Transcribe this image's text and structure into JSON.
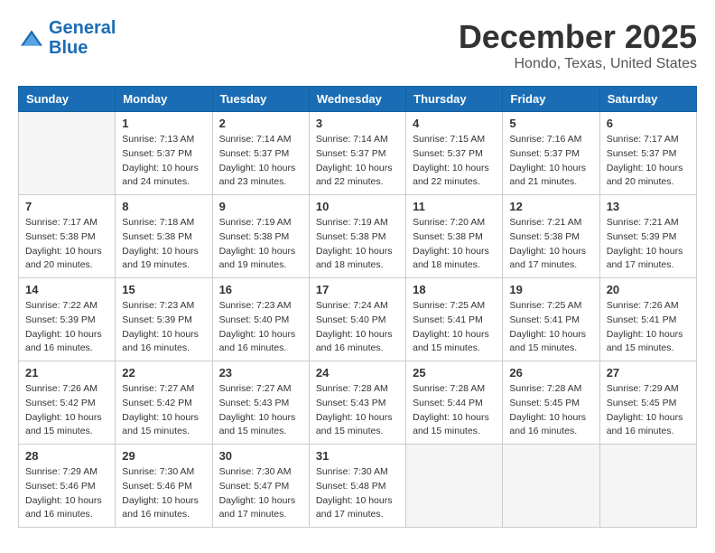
{
  "logo": {
    "line1": "General",
    "line2": "Blue"
  },
  "title": "December 2025",
  "location": "Hondo, Texas, United States",
  "days_of_week": [
    "Sunday",
    "Monday",
    "Tuesday",
    "Wednesday",
    "Thursday",
    "Friday",
    "Saturday"
  ],
  "weeks": [
    [
      {
        "day": "",
        "empty": true
      },
      {
        "day": "1",
        "sunrise": "7:13 AM",
        "sunset": "5:37 PM",
        "daylight": "10 hours and 24 minutes."
      },
      {
        "day": "2",
        "sunrise": "7:14 AM",
        "sunset": "5:37 PM",
        "daylight": "10 hours and 23 minutes."
      },
      {
        "day": "3",
        "sunrise": "7:14 AM",
        "sunset": "5:37 PM",
        "daylight": "10 hours and 22 minutes."
      },
      {
        "day": "4",
        "sunrise": "7:15 AM",
        "sunset": "5:37 PM",
        "daylight": "10 hours and 22 minutes."
      },
      {
        "day": "5",
        "sunrise": "7:16 AM",
        "sunset": "5:37 PM",
        "daylight": "10 hours and 21 minutes."
      },
      {
        "day": "6",
        "sunrise": "7:17 AM",
        "sunset": "5:37 PM",
        "daylight": "10 hours and 20 minutes."
      }
    ],
    [
      {
        "day": "7",
        "sunrise": "7:17 AM",
        "sunset": "5:38 PM",
        "daylight": "10 hours and 20 minutes."
      },
      {
        "day": "8",
        "sunrise": "7:18 AM",
        "sunset": "5:38 PM",
        "daylight": "10 hours and 19 minutes."
      },
      {
        "day": "9",
        "sunrise": "7:19 AM",
        "sunset": "5:38 PM",
        "daylight": "10 hours and 19 minutes."
      },
      {
        "day": "10",
        "sunrise": "7:19 AM",
        "sunset": "5:38 PM",
        "daylight": "10 hours and 18 minutes."
      },
      {
        "day": "11",
        "sunrise": "7:20 AM",
        "sunset": "5:38 PM",
        "daylight": "10 hours and 18 minutes."
      },
      {
        "day": "12",
        "sunrise": "7:21 AM",
        "sunset": "5:38 PM",
        "daylight": "10 hours and 17 minutes."
      },
      {
        "day": "13",
        "sunrise": "7:21 AM",
        "sunset": "5:39 PM",
        "daylight": "10 hours and 17 minutes."
      }
    ],
    [
      {
        "day": "14",
        "sunrise": "7:22 AM",
        "sunset": "5:39 PM",
        "daylight": "10 hours and 16 minutes."
      },
      {
        "day": "15",
        "sunrise": "7:23 AM",
        "sunset": "5:39 PM",
        "daylight": "10 hours and 16 minutes."
      },
      {
        "day": "16",
        "sunrise": "7:23 AM",
        "sunset": "5:40 PM",
        "daylight": "10 hours and 16 minutes."
      },
      {
        "day": "17",
        "sunrise": "7:24 AM",
        "sunset": "5:40 PM",
        "daylight": "10 hours and 16 minutes."
      },
      {
        "day": "18",
        "sunrise": "7:25 AM",
        "sunset": "5:41 PM",
        "daylight": "10 hours and 15 minutes."
      },
      {
        "day": "19",
        "sunrise": "7:25 AM",
        "sunset": "5:41 PM",
        "daylight": "10 hours and 15 minutes."
      },
      {
        "day": "20",
        "sunrise": "7:26 AM",
        "sunset": "5:41 PM",
        "daylight": "10 hours and 15 minutes."
      }
    ],
    [
      {
        "day": "21",
        "sunrise": "7:26 AM",
        "sunset": "5:42 PM",
        "daylight": "10 hours and 15 minutes."
      },
      {
        "day": "22",
        "sunrise": "7:27 AM",
        "sunset": "5:42 PM",
        "daylight": "10 hours and 15 minutes."
      },
      {
        "day": "23",
        "sunrise": "7:27 AM",
        "sunset": "5:43 PM",
        "daylight": "10 hours and 15 minutes."
      },
      {
        "day": "24",
        "sunrise": "7:28 AM",
        "sunset": "5:43 PM",
        "daylight": "10 hours and 15 minutes."
      },
      {
        "day": "25",
        "sunrise": "7:28 AM",
        "sunset": "5:44 PM",
        "daylight": "10 hours and 15 minutes."
      },
      {
        "day": "26",
        "sunrise": "7:28 AM",
        "sunset": "5:45 PM",
        "daylight": "10 hours and 16 minutes."
      },
      {
        "day": "27",
        "sunrise": "7:29 AM",
        "sunset": "5:45 PM",
        "daylight": "10 hours and 16 minutes."
      }
    ],
    [
      {
        "day": "28",
        "sunrise": "7:29 AM",
        "sunset": "5:46 PM",
        "daylight": "10 hours and 16 minutes."
      },
      {
        "day": "29",
        "sunrise": "7:30 AM",
        "sunset": "5:46 PM",
        "daylight": "10 hours and 16 minutes."
      },
      {
        "day": "30",
        "sunrise": "7:30 AM",
        "sunset": "5:47 PM",
        "daylight": "10 hours and 17 minutes."
      },
      {
        "day": "31",
        "sunrise": "7:30 AM",
        "sunset": "5:48 PM",
        "daylight": "10 hours and 17 minutes."
      },
      {
        "day": "",
        "empty": true
      },
      {
        "day": "",
        "empty": true
      },
      {
        "day": "",
        "empty": true
      }
    ]
  ],
  "labels": {
    "sunrise": "Sunrise:",
    "sunset": "Sunset:",
    "daylight": "Daylight:"
  }
}
